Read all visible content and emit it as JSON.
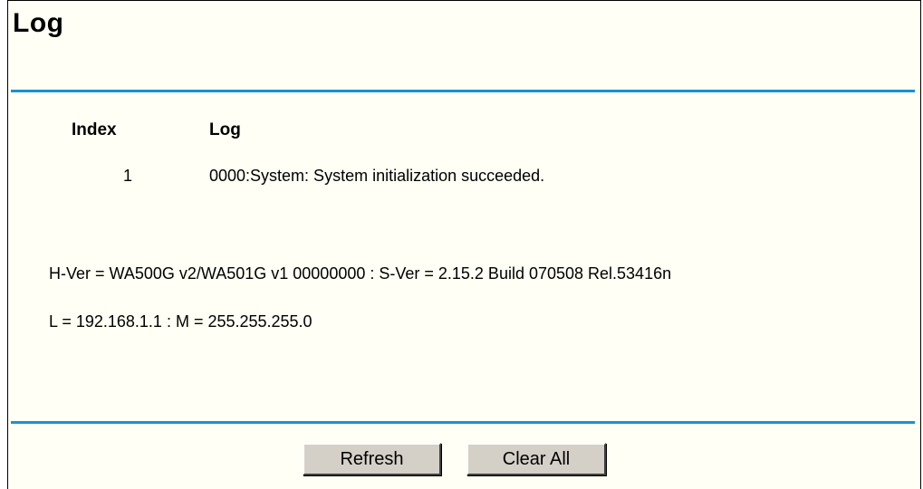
{
  "page": {
    "title": "Log"
  },
  "log_table": {
    "columns": [
      "Index",
      "Log"
    ],
    "rows": [
      {
        "index": "1",
        "log": "0000:System: System initialization succeeded."
      }
    ]
  },
  "info": {
    "version_line": "H-Ver = WA500G v2/WA501G v1 00000000 : S-Ver = 2.15.2 Build 070508 Rel.53416n",
    "lan_line": "L = 192.168.1.1 : M = 255.255.255.0"
  },
  "buttons": {
    "refresh": "Refresh",
    "clear_all": "Clear All"
  },
  "colors": {
    "rule": "#1893cc",
    "background": "#fffff5",
    "button": "#d4d0c8"
  }
}
